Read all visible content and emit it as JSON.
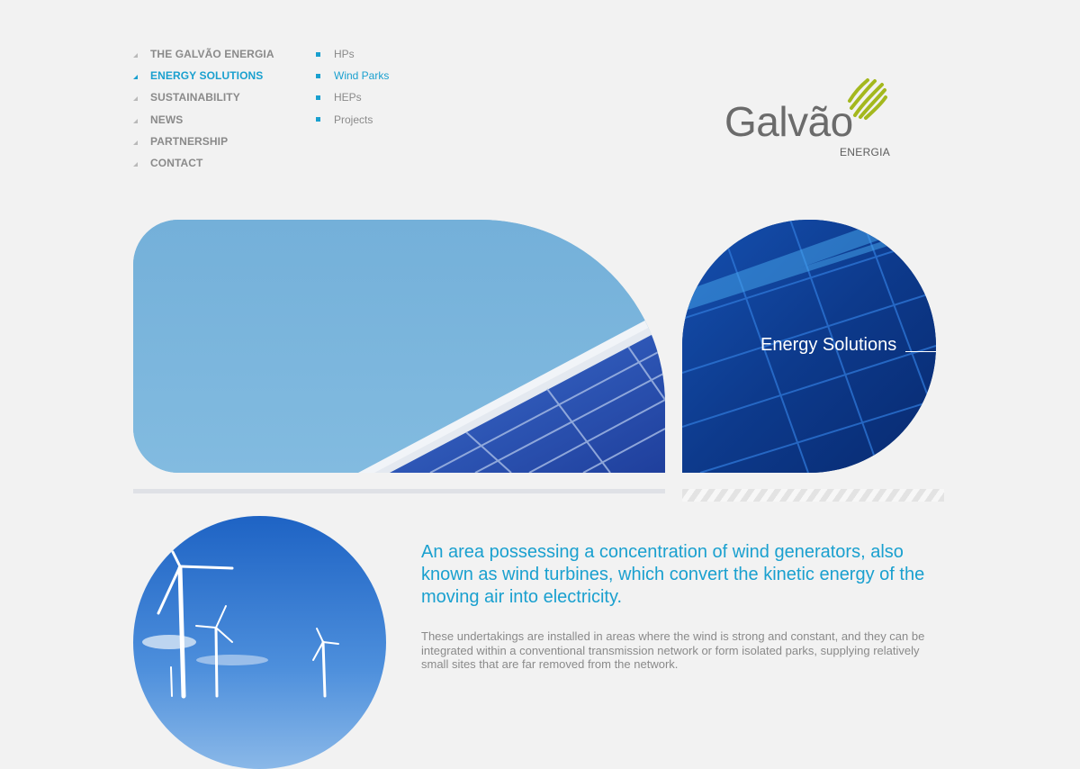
{
  "nav": {
    "main": [
      {
        "label": "THE GALVÃO ENERGIA",
        "active": false
      },
      {
        "label": "ENERGY SOLUTIONS",
        "active": true
      },
      {
        "label": "SUSTAINABILITY",
        "active": false
      },
      {
        "label": "NEWS",
        "active": false
      },
      {
        "label": "PARTNERSHIP",
        "active": false
      },
      {
        "label": "CONTACT",
        "active": false
      }
    ],
    "sub": [
      {
        "label": "HPs",
        "active": false
      },
      {
        "label": "Wind Parks",
        "active": true
      },
      {
        "label": "HEPs",
        "active": false
      },
      {
        "label": "Projects",
        "active": false
      }
    ]
  },
  "logo": {
    "word": "Galvão",
    "sub": "ENERGIA"
  },
  "hero": {
    "title": "Energy Solutions"
  },
  "content": {
    "lead": "An area possessing a concentration of wind generators, also known as wind turbines, which convert the kinetic energy of the moving air into electricity.",
    "body": "These undertakings are installed in areas where the wind is strong and constant, and they can be integrated within a conventional transmission network or form isolated parks, supplying relatively small sites that are far removed from the network."
  },
  "colors": {
    "accent": "#1aa0cf",
    "nav_text": "#8a8a8a",
    "logo_green": "#a4b81e",
    "background": "#f2f2f2"
  },
  "icons": {
    "nav_marker": "triangle-bullet-icon",
    "sub_marker": "square-bullet-icon",
    "logo_mark": "globe-icon"
  }
}
